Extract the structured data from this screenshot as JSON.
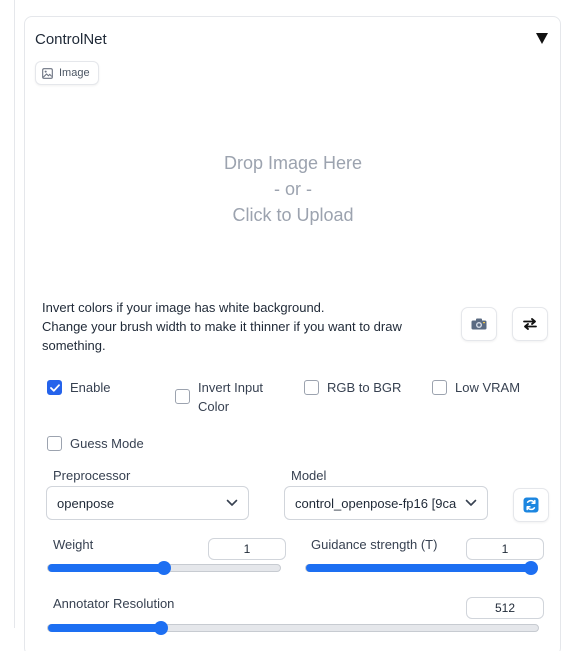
{
  "panel": {
    "title": "ControlNet",
    "image_tab_label": "Image"
  },
  "upload": {
    "line1": "Drop Image Here",
    "line2": "- or -",
    "line3": "Click to Upload"
  },
  "hint": {
    "line1": "Invert colors if your image has white background.",
    "line2": "Change your brush width to make it thinner if you want to draw something."
  },
  "options": {
    "enable": {
      "label": "Enable",
      "checked": true
    },
    "invert_input_color": {
      "label": "Invert Input Color",
      "checked": false
    },
    "rgb_to_bgr": {
      "label": "RGB to BGR",
      "checked": false
    },
    "low_vram": {
      "label": "Low VRAM",
      "checked": false
    },
    "guess_mode": {
      "label": "Guess Mode",
      "checked": false
    }
  },
  "preprocessor": {
    "label": "Preprocessor",
    "value": "openpose"
  },
  "model": {
    "label": "Model",
    "value": "control_openpose-fp16 [9ca"
  },
  "weight": {
    "label": "Weight",
    "value": "1",
    "fraction": 0.5
  },
  "guidance_strength": {
    "label": "Guidance strength (T)",
    "value": "1",
    "fraction": 1.0
  },
  "annotator_resolution": {
    "label": "Annotator Resolution",
    "value": "512",
    "fraction": 0.23
  },
  "colors": {
    "accent": "#1d6ff2",
    "checkbox": "#2563eb",
    "muted": "#9ca3af"
  }
}
